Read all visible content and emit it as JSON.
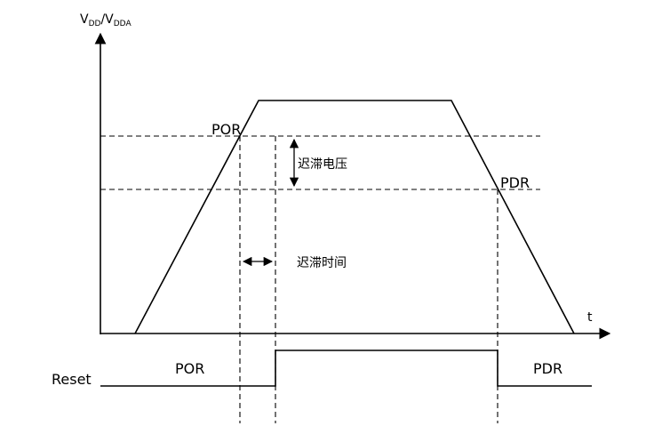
{
  "axis": {
    "y_label_main": "V",
    "y_label_sub1": "DD",
    "y_label_sep": "/V",
    "y_label_sub2": "DDA",
    "x_label": "t"
  },
  "thresholds": {
    "por": "POR",
    "pdr": "PDR"
  },
  "annotations": {
    "hysteresis_voltage": "迟滞电压",
    "hysteresis_time": "迟滞时间"
  },
  "reset_signal": {
    "label": "Reset",
    "low_left_label": "POR",
    "low_right_label": "PDR"
  }
}
